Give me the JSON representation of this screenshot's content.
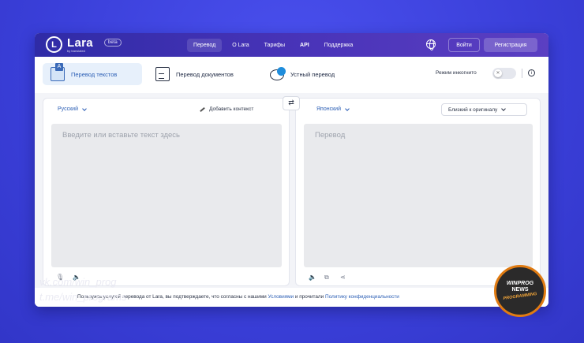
{
  "nav": {
    "logo_glyph": "L",
    "logo_name": "Lara",
    "logo_sub": "by translated",
    "beta": "beta",
    "links": [
      {
        "label": "Перевод"
      },
      {
        "label": "О Lara"
      },
      {
        "label": "Тарифы"
      },
      {
        "label": "API"
      },
      {
        "label": "Поддержка"
      }
    ],
    "login": "Войти",
    "register": "Регистрация"
  },
  "modes": {
    "text": "Перевод текстов",
    "documents": "Перевод документов",
    "voice": "Устный перевод",
    "incognito_label": "Режим инкогнито",
    "toggle_glyph": "✕",
    "info_glyph": "i"
  },
  "source": {
    "language": "Русский",
    "add_context": "Добавить контекст",
    "placeholder": "Введите или вставьте текст здесь",
    "mic_glyph": "🎙",
    "speaker_glyph": "🔈"
  },
  "swap_glyph": "⇄",
  "target": {
    "language": "Японский",
    "style": "Близкий к оригиналу",
    "placeholder": "Перевод",
    "speaker_glyph": "🔈",
    "copy_glyph": "⧉",
    "share_glyph": "⋖"
  },
  "footer": {
    "prefix": "Пользуясь услугой перевода от Lara, вы подтверждаете, что согласны с нашими ",
    "terms": "Условиями",
    "middle": " и прочитали ",
    "privacy": "Политику конфиденциальности"
  },
  "watermark": {
    "vk": "vk.com/win_prog",
    "tg": "t.me/win_programs"
  },
  "badge": {
    "line1": "WINPROG",
    "line2": "NEWS",
    "line3": "PROGRAMMING"
  },
  "colors": {
    "background": "#3d44e0",
    "nav": "#4a34b9",
    "accent": "#2c5fb5",
    "badge_ring": "#e07b12"
  }
}
